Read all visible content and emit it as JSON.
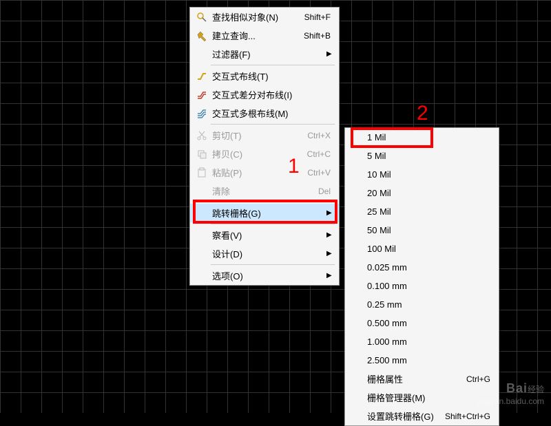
{
  "main_menu": {
    "items": [
      {
        "icon": "search",
        "label": "查找相似对象(N)",
        "shortcut": "Shift+F",
        "arrow": false
      },
      {
        "icon": "hammer",
        "label": "建立查询...",
        "shortcut": "Shift+B",
        "arrow": false
      },
      {
        "icon": "",
        "label": "过滤器(F)",
        "shortcut": "",
        "arrow": true
      },
      {
        "sep": true
      },
      {
        "icon": "route-y",
        "label": "交互式布线(T)",
        "shortcut": "",
        "arrow": false
      },
      {
        "icon": "route-r",
        "label": "交互式差分对布线(I)",
        "shortcut": "",
        "arrow": false
      },
      {
        "icon": "route-b",
        "label": "交互式多根布线(M)",
        "shortcut": "",
        "arrow": false
      },
      {
        "sep": true
      },
      {
        "icon": "cut",
        "label": "剪切(T)",
        "shortcut": "Ctrl+X",
        "arrow": false,
        "disabled": true
      },
      {
        "icon": "copy",
        "label": "拷贝(C)",
        "shortcut": "Ctrl+C",
        "arrow": false,
        "disabled": true
      },
      {
        "icon": "paste",
        "label": "粘贴(P)",
        "shortcut": "Ctrl+V",
        "arrow": false,
        "disabled": true
      },
      {
        "icon": "",
        "label": "清除",
        "shortcut": "Del",
        "arrow": false,
        "disabled": true
      },
      {
        "sep": true
      },
      {
        "icon": "",
        "label": "跳转栅格(G)",
        "shortcut": "",
        "arrow": true,
        "highlighted": true
      },
      {
        "sep": true
      },
      {
        "icon": "",
        "label": "察看(V)",
        "shortcut": "",
        "arrow": true
      },
      {
        "icon": "",
        "label": "设计(D)",
        "shortcut": "",
        "arrow": true
      },
      {
        "sep": true
      },
      {
        "icon": "",
        "label": "选项(O)",
        "shortcut": "",
        "arrow": true
      }
    ]
  },
  "sub_menu": {
    "items": [
      {
        "label": "1 Mil",
        "shortcut": ""
      },
      {
        "label": "5 Mil",
        "shortcut": ""
      },
      {
        "label": "10 Mil",
        "shortcut": ""
      },
      {
        "label": "20 Mil",
        "shortcut": ""
      },
      {
        "label": "25 Mil",
        "shortcut": ""
      },
      {
        "label": "50 Mil",
        "shortcut": ""
      },
      {
        "label": "100 Mil",
        "shortcut": ""
      },
      {
        "label": "0.025 mm",
        "shortcut": ""
      },
      {
        "label": "0.100 mm",
        "shortcut": ""
      },
      {
        "label": "0.25 mm",
        "shortcut": ""
      },
      {
        "label": "0.500 mm",
        "shortcut": ""
      },
      {
        "label": "1.000 mm",
        "shortcut": ""
      },
      {
        "label": "2.500 mm",
        "shortcut": ""
      },
      {
        "label": "栅格属性",
        "shortcut": "Ctrl+G"
      },
      {
        "label": "栅格管理器(M)",
        "shortcut": ""
      },
      {
        "label": "设置跳转栅格(G)",
        "shortcut": "Shift+Ctrl+G"
      }
    ]
  },
  "annotations": {
    "label1": "1",
    "label2": "2"
  },
  "watermark": {
    "line1": "Bai",
    "line2": "经验",
    "line3": "jingyan.baidu.com"
  }
}
